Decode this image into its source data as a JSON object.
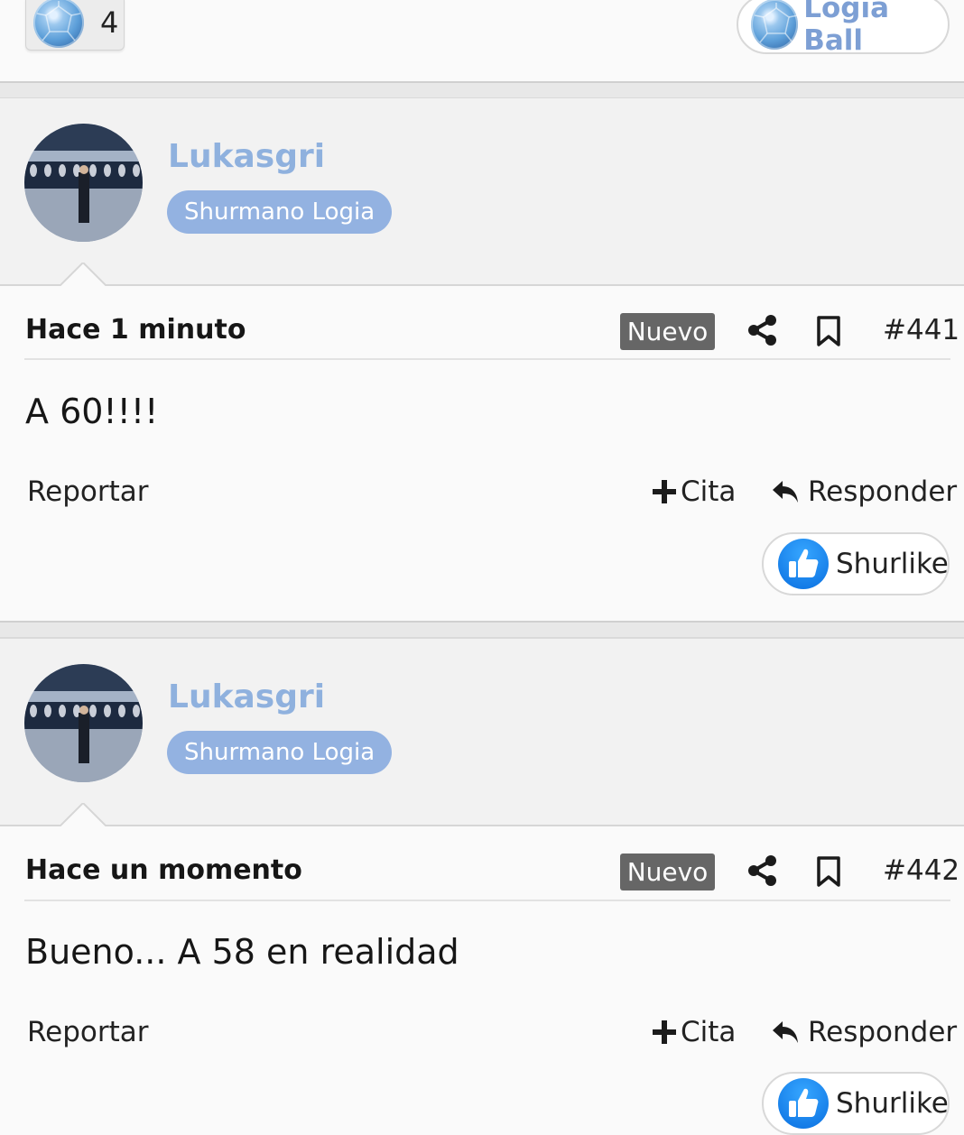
{
  "top_footer": {
    "reaction_count": "4",
    "logia_ball_label": "Logia Ball"
  },
  "posts": [
    {
      "username": "Lukasgri",
      "role": "Shurmano Logia",
      "time": "Hace 1 minuto",
      "badge": "Nuevo",
      "number": "#441",
      "body": "A 60!!!!",
      "report": "Reportar",
      "quote": "Cita",
      "reply": "Responder",
      "like": "Shurlike"
    },
    {
      "username": "Lukasgri",
      "role": "Shurmano Logia",
      "time": "Hace un momento",
      "badge": "Nuevo",
      "number": "#442",
      "body": "Bueno... A 58 en realidad",
      "report": "Reportar",
      "quote": "Cita",
      "reply": "Responder",
      "like": "Shurlike"
    }
  ],
  "icons": {
    "share": "share-icon",
    "bookmark": "bookmark-icon",
    "plus": "plus-icon",
    "reply_arrow": "reply-arrow-icon",
    "thumbs_up": "thumbs-up-icon",
    "gem": "diamond-ball-icon"
  },
  "colors": {
    "username": "#8fb1de",
    "role_badge": "#93b2e1",
    "new_badge": "#666666",
    "like_blue": "#0a6fe0"
  }
}
